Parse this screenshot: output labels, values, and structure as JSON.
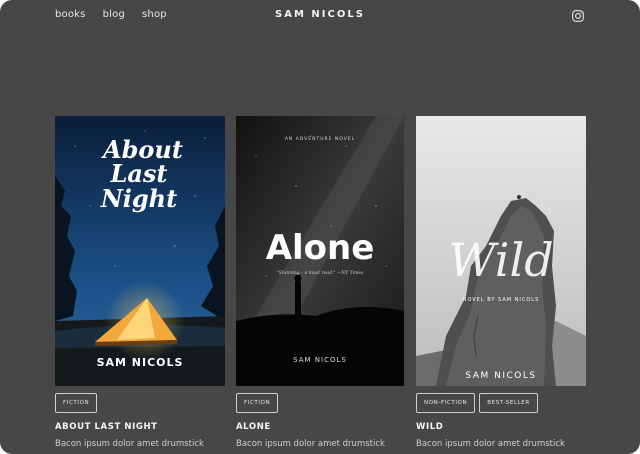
{
  "nav": {
    "links": [
      "books",
      "blog",
      "shop"
    ]
  },
  "brand": "SAM NICOLS",
  "icons": {
    "social": "instagram-icon"
  },
  "colors": {
    "background": "#474747",
    "text": "#f2f2f2"
  },
  "books": [
    {
      "cover_title": "About Last Night",
      "cover_author": "SAM NICOLS",
      "tags": [
        "FICTION"
      ],
      "title": "ABOUT LAST NIGHT",
      "description": "Bacon ipsum dolor amet drumstick"
    },
    {
      "cover_kicker": "AN ADVENTURE NOVEL",
      "cover_title": "Alone",
      "cover_quote": "\"Stunning – a must read.\" —NY Times",
      "cover_author": "SAM NICOLS",
      "tags": [
        "FICTION"
      ],
      "title": "ALONE",
      "description": "Bacon ipsum dolor amet drumstick"
    },
    {
      "cover_title": "Wild",
      "cover_subtitle": "NOVEL BY SAM NICOLS",
      "cover_author": "SAM NICOLS",
      "tags": [
        "NON-FICTION",
        "BEST-SELLER"
      ],
      "title": "WILD",
      "description": "Bacon ipsum dolor amet drumstick"
    }
  ]
}
